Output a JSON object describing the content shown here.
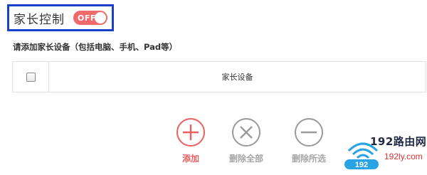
{
  "parental_control": {
    "title": "家长控制",
    "toggle_state": "OFF"
  },
  "instruction": "请添加家长设备（包括电脑、手机、Pad等）",
  "device_table": {
    "columns": [
      "",
      "家长设备"
    ]
  },
  "actions": {
    "add": "添加",
    "delete_all": "删除全部",
    "delete_selected": "删除所选"
  },
  "watermark": {
    "brand": "192路由网",
    "site": "192ly.com"
  },
  "colors": {
    "highlight_border": "#1a3fc8",
    "toggle_off": "#ef6b6b",
    "add_accent": "#ec5f5f",
    "muted": "#9a9a9a"
  }
}
